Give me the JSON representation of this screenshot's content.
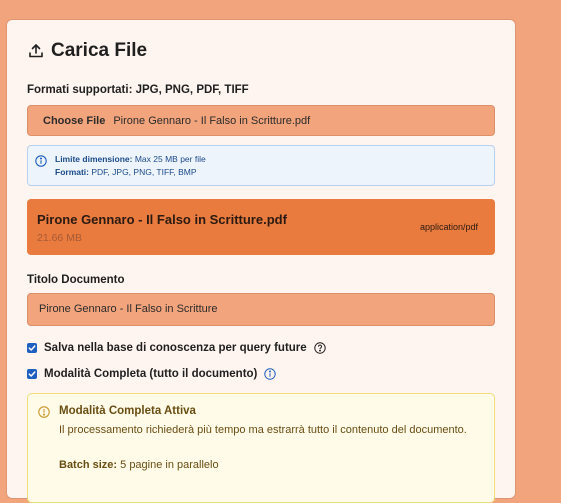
{
  "card": {
    "title": "Carica File",
    "upload_icon": "upload-icon"
  },
  "formats_label": "Formati supportati: JPG, PNG, PDF, TIFF",
  "file_input": {
    "button_label": "Choose File",
    "file_name": "Pirone Gennaro - Il Falso in  Scritture.pdf"
  },
  "info": {
    "size_label": "Limite dimensione:",
    "size_value": "Max 25 MB per file",
    "formats_label": "Formati:",
    "formats_value": "PDF, JPG, PNG, TIFF, BMP"
  },
  "selected_file": {
    "name": "Pirone Gennaro - Il Falso in Scritture.pdf",
    "size": "21.66 MB",
    "type": "application/pdf"
  },
  "doc_title": {
    "label": "Titolo Documento",
    "value": "Pirone Gennaro - Il Falso in  Scritture"
  },
  "options": {
    "save_kb": {
      "label": "Salva nella base di conoscenza per query future",
      "checked": true
    },
    "full_mode": {
      "label": "Modalità Completa (tutto il documento)",
      "checked": true
    }
  },
  "warning": {
    "title": "Modalità Completa Attiva",
    "body": "Il processamento richiederà più tempo ma estrarrà tutto il contenuto del documento.",
    "batch_label": "Batch size:",
    "batch_value": "5 pagine in parallelo"
  },
  "colors": {
    "background": "#f2a47c",
    "card": "#fff5f0",
    "file_card": "#e97b3e",
    "checkbox": "#1f5fbf",
    "info_text": "#1b4a8a",
    "warning_bg": "#fffbe8"
  }
}
